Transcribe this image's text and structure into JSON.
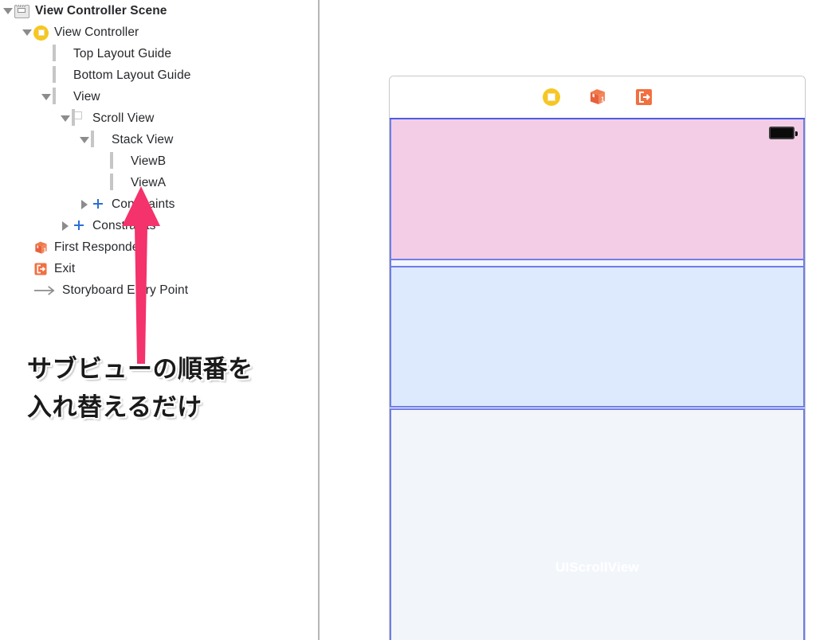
{
  "outline": {
    "rows": [
      {
        "label": "View Controller Scene",
        "icon": "scene-icon",
        "disclosure": "open",
        "depth": 0,
        "bold": true
      },
      {
        "label": "View Controller",
        "icon": "view-controller-icon",
        "disclosure": "open",
        "depth": 1,
        "bold": false
      },
      {
        "label": "Top Layout Guide",
        "icon": "top-layout-guide-icon",
        "disclosure": "none",
        "depth": 2,
        "bold": false
      },
      {
        "label": "Bottom Layout Guide",
        "icon": "bottom-layout-guide-icon",
        "disclosure": "none",
        "depth": 2,
        "bold": false
      },
      {
        "label": "View",
        "icon": "view-icon",
        "disclosure": "open",
        "depth": 2,
        "bold": false
      },
      {
        "label": "Scroll View",
        "icon": "scroll-view-icon",
        "disclosure": "open",
        "depth": 3,
        "bold": false
      },
      {
        "label": "Stack View",
        "icon": "stack-view-icon",
        "disclosure": "open",
        "depth": 4,
        "bold": false
      },
      {
        "label": "ViewB",
        "icon": "view-icon",
        "disclosure": "none",
        "depth": 5,
        "bold": false
      },
      {
        "label": "ViewA",
        "icon": "view-icon",
        "disclosure": "none",
        "depth": 5,
        "bold": false
      },
      {
        "label": "Constraints",
        "icon": "constraints-icon",
        "disclosure": "closed",
        "depth": 4,
        "bold": false
      },
      {
        "label": "Constraints",
        "icon": "constraints-icon",
        "disclosure": "closed",
        "depth": 3,
        "bold": false
      },
      {
        "label": "First Responder",
        "icon": "first-responder-icon",
        "disclosure": "none",
        "depth": 1,
        "bold": false
      },
      {
        "label": "Exit",
        "icon": "exit-icon",
        "disclosure": "none",
        "depth": 1,
        "bold": false
      },
      {
        "label": "Storyboard Entry Point",
        "icon": "entry-point-arrow-icon",
        "disclosure": "none",
        "depth": 1,
        "bold": false
      }
    ]
  },
  "annotation": {
    "line1": "サブビューの順番を",
    "line2": "入れ替えるだけ",
    "arrow_color": "#f4326b",
    "arrow_target": "ViewA"
  },
  "canvas": {
    "dock": {
      "items": [
        {
          "name": "view-controller-dock-icon",
          "title": "View Controller"
        },
        {
          "name": "first-responder-dock-icon",
          "title": "First Responder"
        },
        {
          "name": "exit-dock-icon",
          "title": "Exit"
        }
      ]
    },
    "scene": {
      "views": [
        {
          "name": "ViewB",
          "color": "#f3cde5",
          "border": "#6f7ce8"
        },
        {
          "name": "ViewA",
          "color": "#dde9fc",
          "border": "#6f7ce8"
        }
      ],
      "scroll_view_label": "UIScrollView",
      "scroll_view_background": "#f2f6fa",
      "status_icon": "battery-icon"
    },
    "entry_point_indicator": "entry-point-arrow-icon"
  },
  "colors": {
    "pink": "#f3cde5",
    "blue": "#dde9fc",
    "border_blue": "#6f7ce8",
    "accent_pink": "#f4326b",
    "divider_gray": "#b6b6b6"
  }
}
